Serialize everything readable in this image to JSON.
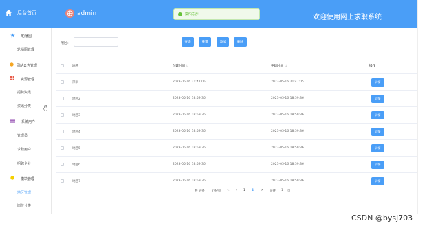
{
  "header": {
    "logo_text": "后台首页",
    "admin_name": "admin",
    "toast_text": "操作成功!",
    "welcome": "欢迎使用网上求职系统",
    "bg_color": "#4a9ef7"
  },
  "sidebar": {
    "items": [
      {
        "label": "轮播图",
        "kind": "group",
        "icon": "star-icon",
        "color": "#4a9ef7"
      },
      {
        "label": "轮播图管理",
        "kind": "sub"
      },
      {
        "label": "网站公告管理",
        "kind": "group",
        "icon": "bell-icon",
        "color": "#f5a623"
      },
      {
        "label": "资源管理",
        "kind": "group",
        "icon": "grid-icon",
        "color": "#e85c4a"
      },
      {
        "label": "招聘资讯",
        "kind": "sub"
      },
      {
        "label": "资讯分类",
        "kind": "sub"
      },
      {
        "label": "系统用户",
        "kind": "group",
        "icon": "users-icon",
        "color": "#9b59b6"
      },
      {
        "label": "管理员",
        "kind": "sub"
      },
      {
        "label": "求职用户",
        "kind": "sub"
      },
      {
        "label": "招聘企业",
        "kind": "sub"
      },
      {
        "label": "模块管理",
        "kind": "group",
        "icon": "module-icon",
        "color": "#f5d000"
      },
      {
        "label": "地区管理",
        "kind": "sub",
        "active": true
      },
      {
        "label": "岗位分类",
        "kind": "sub"
      }
    ]
  },
  "search": {
    "label": "地区:",
    "placeholder": "",
    "buttons": [
      "查询",
      "重置",
      "添加",
      "删除"
    ]
  },
  "table": {
    "headers": {
      "name": "地区",
      "created": "创建时间",
      "updated": "更新时间",
      "op": "操作"
    },
    "rows": [
      {
        "name": "深圳",
        "created": "2023-05-16 21:47:05",
        "updated": "2023-05-16 21:47:05",
        "op": "详情"
      },
      {
        "name": "地区2",
        "created": "2023-05-16 18:59:36",
        "updated": "2023-05-16 18:59:36",
        "op": "详情"
      },
      {
        "name": "地区3",
        "created": "2023-05-16 18:59:36",
        "updated": "2023-05-16 18:59:36",
        "op": "详情"
      },
      {
        "name": "地区4",
        "created": "2023-05-16 18:59:36",
        "updated": "2023-05-16 18:59:36",
        "op": "详情"
      },
      {
        "name": "地区5",
        "created": "2023-05-16 18:59:36",
        "updated": "2023-05-16 18:59:36",
        "op": "详情"
      },
      {
        "name": "地区6",
        "created": "2023-05-16 18:59:36",
        "updated": "2023-05-16 18:59:36",
        "op": "详情"
      },
      {
        "name": "地区7",
        "created": "2023-05-16 18:59:36",
        "updated": "2023-05-16 18:59:36",
        "op": "详情"
      }
    ]
  },
  "pager": {
    "total": "共 9 条",
    "page_size": "7条/页",
    "prev": "<",
    "pages": [
      "1",
      "2"
    ],
    "next": ">",
    "goto_label": "前往",
    "goto_value": "1",
    "goto_suffix": "页"
  },
  "watermark": "CSDN @bysj703"
}
